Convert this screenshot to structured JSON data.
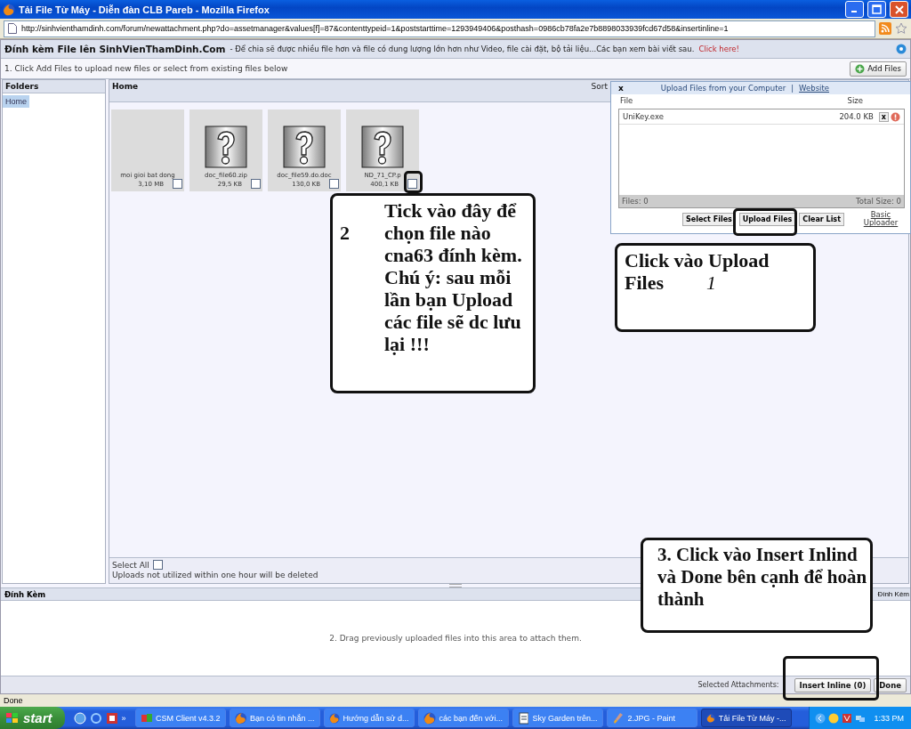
{
  "window": {
    "title": "Tải File Từ Máy - Diễn đàn CLB Pareb - Mozilla Firefox"
  },
  "address": {
    "value": "http://sinhvienthamdinh.com/forum/newattachment.php?do=assetmanager&values[f]=87&contenttypeid=1&poststarttime=1293949406&posthash=0986cb78fa2e7b8898033939fcd67d58&insertinline=1"
  },
  "info_bar": {
    "title": "Đính kèm File lên SinhVienThamDinh.Com",
    "text": "- Để chia sẽ được nhiều file hơn và file có dung lượng lớn hơn như Video, file cài đặt, bộ tải liệu...Các bạn xem bài viết sau.",
    "link": "Click here!"
  },
  "instructions": {
    "text": "1. Click Add Files to upload new files or select from existing files below",
    "button": "Add Files"
  },
  "folders": {
    "title": "Folders",
    "items": [
      {
        "label": "Home",
        "selected": true
      }
    ]
  },
  "content": {
    "title": "Home",
    "sort": "Sort",
    "files": [
      {
        "kind": "blank",
        "name": "moi gioi bat dong",
        "size": "3,10 MB",
        "checked": false
      },
      {
        "kind": "unknown",
        "name": "doc_file60.zip",
        "size": "29,5 KB",
        "checked": false
      },
      {
        "kind": "unknown",
        "name": "doc_file59.do.doc",
        "size": "130,0 KB",
        "checked": false
      },
      {
        "kind": "unknown",
        "name": "ND_71_CP.p",
        "size": "400,1 KB",
        "checked": false
      }
    ],
    "select_all": {
      "label": "Select All",
      "checked": false
    },
    "note": "Uploads not utilized within one hour will be deleted"
  },
  "upload_dialog": {
    "close": "x",
    "title": "Upload Files from your Computer",
    "separator": "|",
    "link": "Website",
    "columns": [
      "File",
      "Size"
    ],
    "rows": [
      {
        "file": "UniKey.exe",
        "size": "204.0 KB",
        "remove": "x"
      }
    ],
    "files_count": "Files: 0",
    "total_size": "Total Size: 0",
    "buttons": [
      "Select Files",
      "Upload Files",
      "Clear List"
    ],
    "basic_link": "Basic Uploader"
  },
  "attachments": {
    "title": "Đính Kèm",
    "title_right": "Đính Kèm",
    "hint": "2. Drag previously uploaded files into this area to attach them.",
    "selected_label": "Selected Attachments:",
    "buttons": [
      "Insert Inline (0)",
      "Done"
    ]
  },
  "status_bar": {
    "text": "Done"
  },
  "taskbar": {
    "start": "start",
    "chevron": "»",
    "tasks": [
      {
        "label": "CSM Client v4.3.2",
        "kind": "app",
        "selected": false
      },
      {
        "label": "Bạn có tin nhắn ...",
        "kind": "browser",
        "selected": false
      },
      {
        "label": "Hướng dẫn sử d...",
        "kind": "browser",
        "selected": false
      },
      {
        "label": "các bạn đến với...",
        "kind": "browser",
        "selected": false
      },
      {
        "label": "Sky Garden trên...",
        "kind": "doc",
        "selected": false
      },
      {
        "label": "2.JPG - Paint",
        "kind": "paint",
        "selected": false
      },
      {
        "label": "Tải File Từ Máy -...",
        "kind": "browser",
        "selected": true
      }
    ],
    "clock": "1:33 PM"
  },
  "callouts": [
    {
      "kind": "numbered",
      "number": "2",
      "text": "Tick vào đây để chọn file nào cna63 đính kèm. Chú ý: sau mỗi lần bạn Upload các file sẽ dc lưu lại !!!"
    },
    {
      "kind": "inline",
      "lines": [
        "Click vào Upload",
        "Files"
      ],
      "number": "1"
    },
    {
      "kind": "plain",
      "text": "3. Click vào Insert Inlind và Done bên cạnh để hoàn thành"
    }
  ]
}
